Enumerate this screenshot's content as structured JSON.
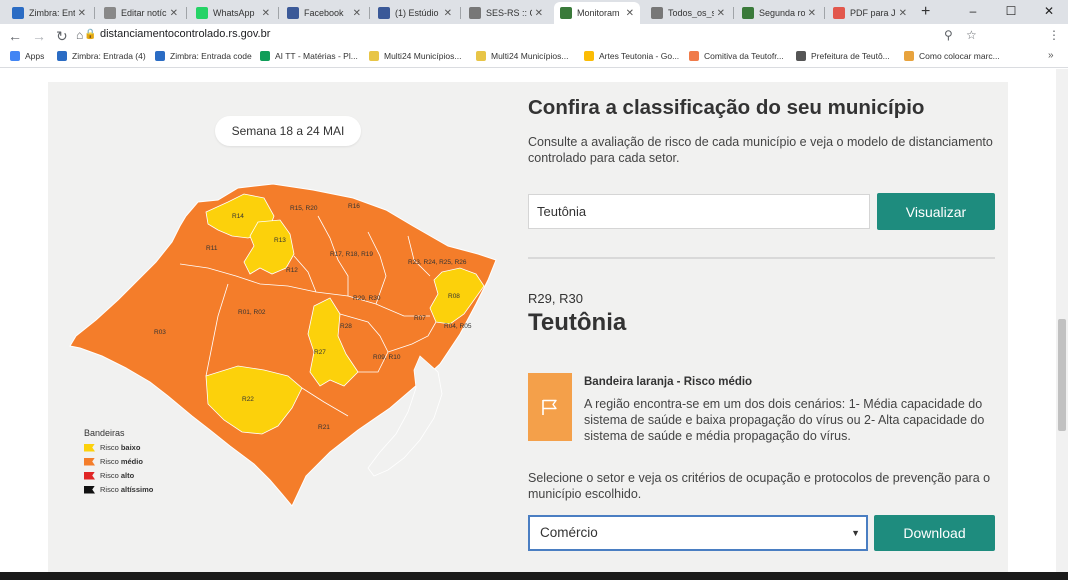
{
  "browser": {
    "tabs": [
      {
        "label": "Zimbra: Entr",
        "icon": "zimbra-icon",
        "color": "#2b6cc4"
      },
      {
        "label": "Editar notíci",
        "icon": "document-icon",
        "color": "#888888"
      },
      {
        "label": "WhatsApp",
        "icon": "whatsapp-icon",
        "color": "#25d366"
      },
      {
        "label": "Facebook",
        "icon": "facebook-icon",
        "color": "#3b5998"
      },
      {
        "label": "(1) Estúdio d",
        "icon": "facebook-icon",
        "color": "#3b5998"
      },
      {
        "label": "SES-RS :: Co",
        "icon": "globe-icon",
        "color": "#777777"
      },
      {
        "label": "Monitoram",
        "icon": "rs-shield-icon",
        "color": "#3a7a3a"
      },
      {
        "label": "Todos_os_se",
        "icon": "globe-icon",
        "color": "#777777"
      },
      {
        "label": "Segunda ro",
        "icon": "rs-shield-icon",
        "color": "#3a7a3a"
      },
      {
        "label": "PDF para JP",
        "icon": "pdf-icon",
        "color": "#e2574c"
      }
    ],
    "active_tab_index": 6,
    "url": "distanciamentocontrolado.rs.gov.br",
    "bookmarks": [
      {
        "label": "Apps",
        "color": "#4285f4"
      },
      {
        "label": "Zimbra: Entrada (4)",
        "color": "#2b6cc4"
      },
      {
        "label": "Zimbra: Entrada code",
        "color": "#2b6cc4"
      },
      {
        "label": "AI TT - Matérias - Pl...",
        "color": "#0f9d58"
      },
      {
        "label": "Multi24 Municípios...",
        "color": "#e8c547"
      },
      {
        "label": "Multi24 Municípios...",
        "color": "#e8c547"
      },
      {
        "label": "Artes Teutonia - Go...",
        "color": "#fbbc05"
      },
      {
        "label": "Comitiva da Teutofr...",
        "color": "#f07b4a"
      },
      {
        "label": "Prefeitura de Teutô...",
        "color": "#555555"
      },
      {
        "label": "Como colocar marc...",
        "color": "#e8a33d"
      }
    ],
    "more_bookmarks": "»"
  },
  "map": {
    "week_label": "Semana 18 a 24 MAI",
    "region_labels": [
      "R14",
      "R15, R20",
      "R16",
      "R11",
      "R13",
      "R17, R18, R19",
      "R23, R24, R25, R26",
      "R12",
      "R08",
      "R29, R30",
      "R01, R02",
      "R03",
      "R28",
      "R07",
      "R04, R05",
      "R27",
      "R09, R10",
      "R22",
      "R21"
    ],
    "colors": {
      "orange": "#f47d2a",
      "yellow": "#fcd10b",
      "border": "#ffffff",
      "water": "#f1f1f0"
    },
    "legend": {
      "title": "Bandeiras",
      "items": [
        {
          "prefix": "Risco ",
          "bold": "baixo",
          "color": "#fcd10b"
        },
        {
          "prefix": "Risco ",
          "bold": "médio",
          "color": "#f47d2a"
        },
        {
          "prefix": "Risco ",
          "bold": "alto",
          "color": "#e02525"
        },
        {
          "prefix": "Risco ",
          "bold": "altíssimo",
          "color": "#111111"
        }
      ]
    }
  },
  "panel": {
    "heading": "Confira a classificação do seu município",
    "description": "Consulte a avaliação de risco de cada município e veja o modelo de distanciamento controlado para cada setor.",
    "search_value": "Teutônia",
    "visualizar_label": "Visualizar",
    "regions": "R29, R30",
    "municipio": "Teutônia",
    "risk_title": "Bandeira laranja - Risco médio",
    "risk_description": "A região encontra-se em um dos dois cenários: 1- Média capacidade do sistema de saúde e baixa propagação do vírus ou 2- Alta capacidade do sistema de saúde e média propagação do vírus.",
    "risk_color": "#f4a04a",
    "select_hint": "Selecione o setor e veja os critérios de ocupação e protocolos de prevenção para o município escolhido.",
    "setor_value": "Comércio",
    "download_label": "Download",
    "accent_color": "#1e8c7e"
  }
}
